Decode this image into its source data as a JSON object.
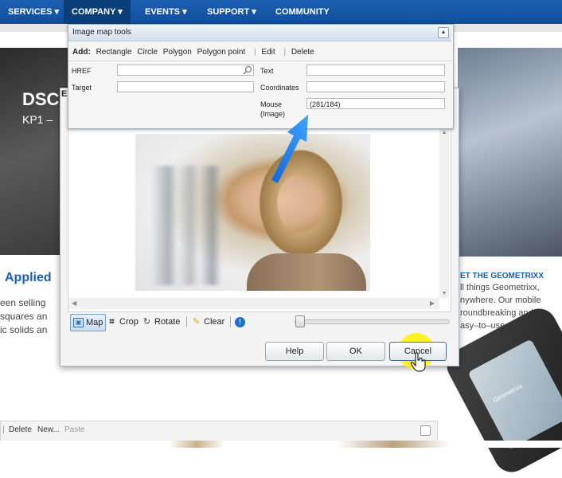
{
  "nav": {
    "items": [
      "SERVICES ▾",
      "COMPANY ▾",
      "EVENTS ▾",
      "SUPPORT ▾",
      "COMMUNITY"
    ]
  },
  "background": {
    "hero_title": "DSC",
    "hero_sub": "KP1 –",
    "heading_applied": "Applied",
    "left_lines": [
      "een selling",
      "squares an",
      "ic solids an"
    ],
    "right_heading": "ET THE GEOMETRIXX",
    "right_lines": [
      "ll things Geometrixx,",
      "nywhere. Our mobile",
      "roundbreaking and re",
      "asy–to–use as our sha"
    ],
    "phone_brand": "Geometrixx",
    "bottom_toolbar": {
      "sep": "|",
      "delete": "Delete",
      "new": "New...",
      "paste": "Paste"
    },
    "dialog_title_stub": "E"
  },
  "image_map_tools": {
    "title": "Image map tools",
    "add_label": "Add:",
    "add_items": [
      "Rectangle",
      "Circle",
      "Polygon",
      "Polygon point"
    ],
    "edit": "Edit",
    "delete": "Delete",
    "href_label": "HREF",
    "href_value": "",
    "target_label": "Target",
    "target_value": "",
    "text_label": "Text",
    "text_value": "",
    "coordinates_label": "Coordinates",
    "coordinates_value": "",
    "mouse_label_1": "Mouse",
    "mouse_label_2": "(Image)",
    "mouse_value": "(281/184)"
  },
  "editor_toolbar": {
    "map": "Map",
    "crop": "Crop",
    "rotate": "Rotate",
    "clear": "Clear"
  },
  "zoom_level": 0,
  "buttons": {
    "help": "Help",
    "ok": "OK",
    "cancel": "Cancel"
  },
  "colors": {
    "nav_blue": "#1d5fb0",
    "arrow_blue": "#1a7fe8",
    "highlight_yellow": "#fff000"
  }
}
